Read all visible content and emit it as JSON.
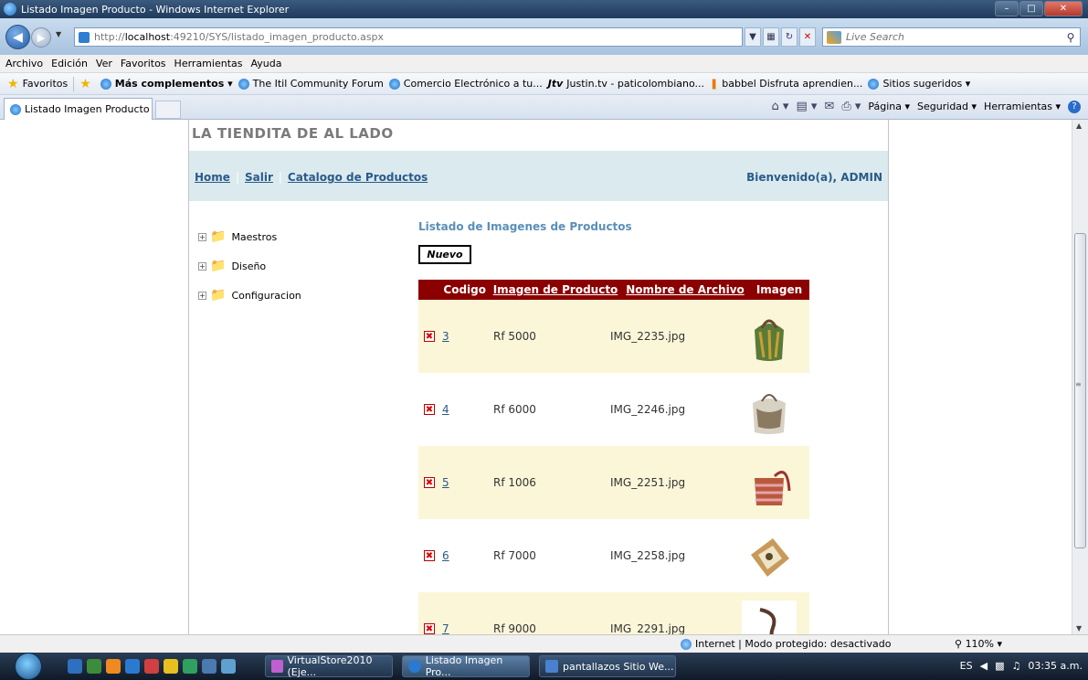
{
  "window": {
    "title": "Listado Imagen Producto - Windows Internet Explorer"
  },
  "address": {
    "url_prefix": "http://",
    "url_host": "localhost",
    "url_rest": ":49210/SYS/listado_imagen_producto.aspx",
    "search_placeholder": "Live Search"
  },
  "menu": {
    "items": [
      "Archivo",
      "Edición",
      "Ver",
      "Favoritos",
      "Herramientas",
      "Ayuda"
    ]
  },
  "favorites": {
    "label": "Favoritos",
    "addons": "Más complementos ▾",
    "links": [
      "The Itil Community Forum",
      "Comercio Electrónico a tu...",
      "Justin.tv - paticolombiano...",
      "babbel Disfruta aprendien...",
      "Sitios sugeridos ▾"
    ]
  },
  "tabs": {
    "active_label": "Listado Imagen Producto"
  },
  "commandbar": {
    "page": "Página ▾",
    "security": "Seguridad ▾",
    "tools": "Herramientas ▾"
  },
  "site": {
    "title": "LA TIENDITA DE AL LADO",
    "nav": [
      "Home",
      "Salir",
      "Catalogo de Productos"
    ],
    "welcome": "Bienvenido(a), ADMIN"
  },
  "tree": [
    "Maestros",
    "Diseño",
    "Configuracion"
  ],
  "listing": {
    "title": "Listado de Imagenes de Productos",
    "new_button": "Nuevo",
    "headers": [
      "Codigo",
      "Imagen de Producto",
      "Nombre de Archivo",
      "Imagen"
    ],
    "rows": [
      {
        "code": "3",
        "product": "Rf 5000",
        "file": "IMG_2235.jpg"
      },
      {
        "code": "4",
        "product": "Rf 6000",
        "file": "IMG_2246.jpg"
      },
      {
        "code": "5",
        "product": "Rf 1006",
        "file": "IMG_2251.jpg"
      },
      {
        "code": "6",
        "product": "Rf 7000",
        "file": "IMG_2258.jpg"
      },
      {
        "code": "7",
        "product": "Rf 9000",
        "file": "IMG_2291.jpg"
      }
    ]
  },
  "status": {
    "zone": "Internet | Modo protegido: desactivado",
    "zoom": "110%"
  },
  "taskbar": {
    "tasks": [
      "VirtualStore2010 (Eje...",
      "Listado Imagen Pro...",
      "pantallazos Sitio We..."
    ],
    "lang": "ES",
    "clock": "03:35 a.m."
  }
}
